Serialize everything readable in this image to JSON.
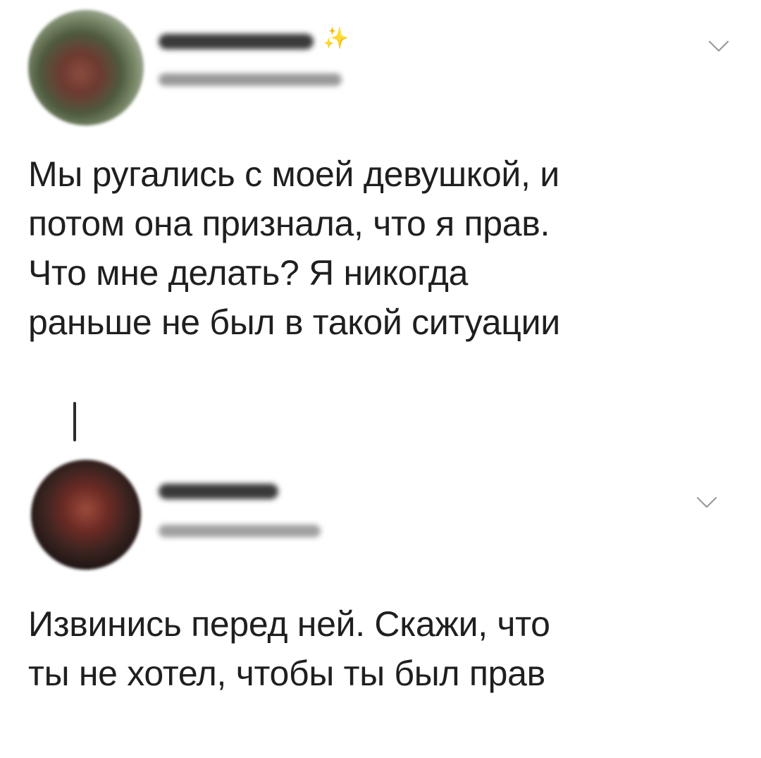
{
  "thread": {
    "posts": [
      {
        "text": "Мы ругались с моей девушкой, и\nпотом она признала, что я прав.\nЧто мне делать? Я никогда\nраньше не был в такой ситуации",
        "has_sparkle": true,
        "sparkle_glyph": "✨"
      },
      {
        "text": "Извинись перед ней. Скажи, что\nты не хотел, чтобы ты был прав"
      }
    ]
  },
  "colors": {
    "background": "#ffffff",
    "text": "#1f1f1f",
    "sparkle": "#e6c44a",
    "chevron": "#9a9a9a"
  },
  "icons": {
    "post_menu": "chevron-down-icon",
    "name_decoration": "sparkle-icon"
  }
}
